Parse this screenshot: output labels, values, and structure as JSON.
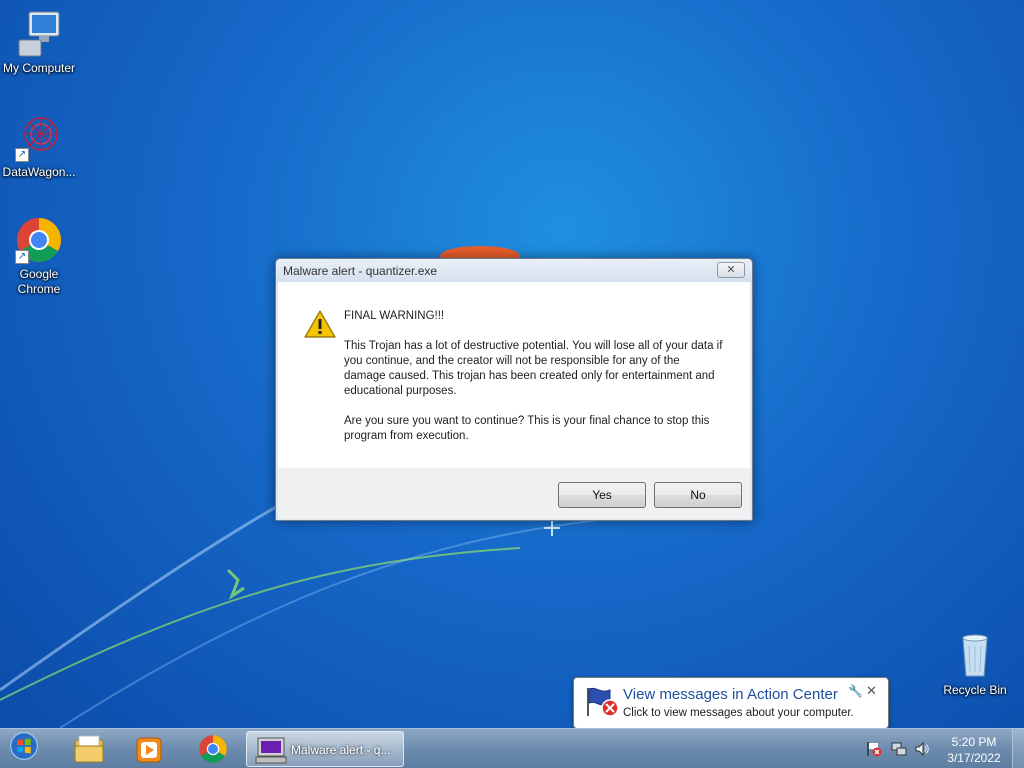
{
  "desktop": {
    "icons": [
      {
        "label": "My Computer"
      },
      {
        "label": "DataWagon..."
      },
      {
        "label": "Google Chrome"
      },
      {
        "label": "Recycle Bin"
      }
    ]
  },
  "dialog": {
    "title": "Malware alert - quantizer.exe",
    "close_glyph": "✕",
    "heading": "FINAL WARNING!!!",
    "body": "This Trojan has a lot of destructive potential. You will lose all of your data if you continue, and the creator will not be responsible for any of the damage caused. This trojan has been created only for entertainment and educational purposes.",
    "question": "Are you sure you want to continue? This is your final chance to stop this program from execution.",
    "yes_label": "Yes",
    "no_label": "No",
    "icon": "warning-icon"
  },
  "balloon": {
    "title": "View messages in Action Center",
    "body": "Click to view messages about your computer.",
    "close_glyph": "✕",
    "options_glyph": "🔧"
  },
  "taskbar": {
    "start_icon": "windows-orb-icon",
    "pinned": [
      {
        "name": "windows-explorer-icon"
      },
      {
        "name": "media-player-icon"
      },
      {
        "name": "chrome-icon"
      }
    ],
    "task_label": "Malware alert - q...",
    "clock": {
      "time": "5:20 PM",
      "date": "3/17/2022"
    }
  },
  "colors": {
    "desktop_bg": "#1668c8",
    "balloon_title": "#1f4e9c",
    "warning_yellow": "#f5c400"
  }
}
